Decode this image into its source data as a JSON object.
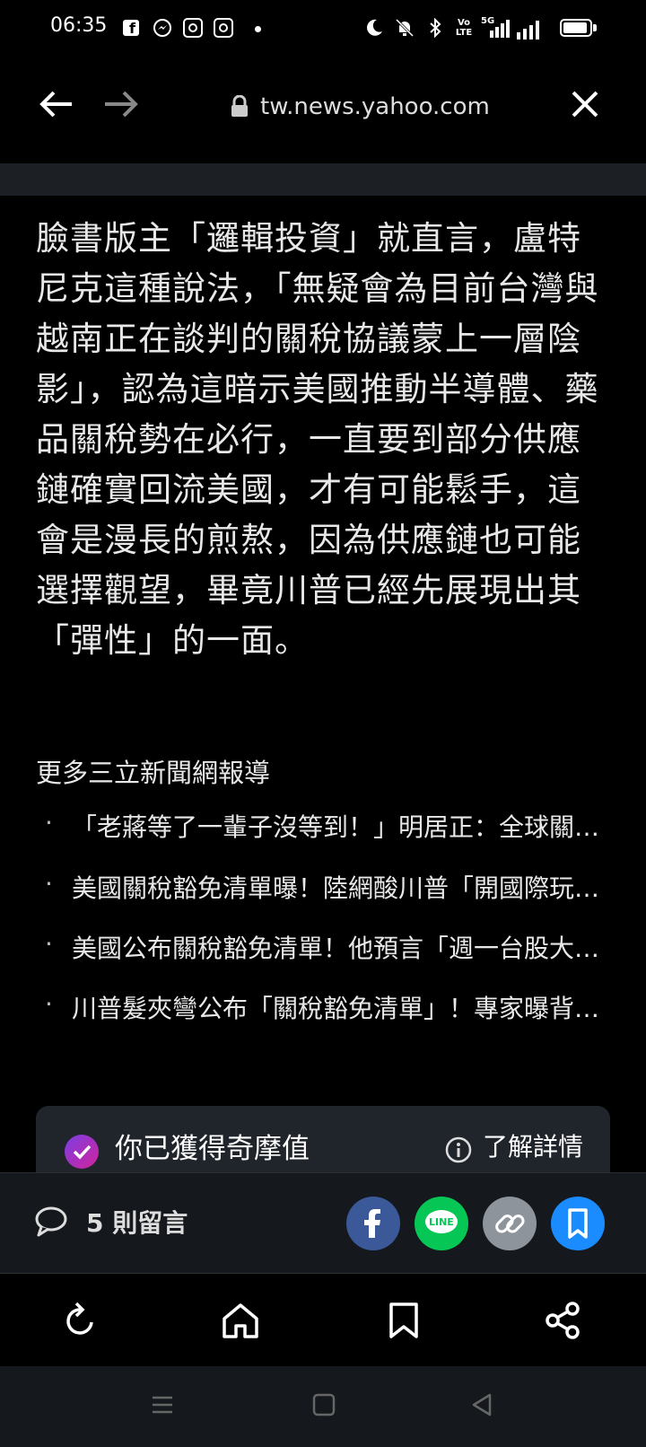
{
  "status_bar": {
    "time": "06:35",
    "notification_icons": [
      "facebook-icon",
      "messenger-icon",
      "instagram-icon",
      "instagram-icon",
      "dot-icon"
    ],
    "system_icons": [
      "moon-icon",
      "bell-muted-icon",
      "bluetooth-icon",
      "volte-icon",
      "signal-5g-icon",
      "signal-icon",
      "battery-icon"
    ],
    "volte_label": "Vo LTE",
    "network_label": "5G"
  },
  "browser": {
    "url": "tw.news.yahoo.com"
  },
  "article": {
    "paragraph": "臉書版主「邏輯投資」就直言，盧特尼克這種說法，「無疑會為目前台灣與越南正在談判的關稅協議蒙上一層陰影」，認為這暗示美國推動半導體、藥品關稅勢在必行，一直要到部分供應鏈確實回流美國，才有可能鬆手，這會是漫長的煎熬，因為供應鏈也可能選擇觀望，畢竟川普已經先展現出其「彈性」的一面。",
    "more_heading": "更多三立新聞網報導",
    "related": [
      {
        "bullet": "·",
        "title": "「老蔣等了一輩子沒等到！」明居正：全球關稅戰台灣最大受益者"
      },
      {
        "bullet": "·",
        "title": "美國關稅豁免清單曝！陸網酸川普「開國際玩笑」"
      },
      {
        "bullet": "·",
        "title": "美國公布關稅豁免清單！他預言「週一台股大反彈」"
      },
      {
        "bullet": "·",
        "title": "川普髮夾彎公布「關稅豁免清單」！專家曝背後原因"
      }
    ]
  },
  "points_card": {
    "text": "你已獲得奇摩值",
    "learn_more": "了解詳情"
  },
  "share_bar": {
    "comments": "5 則留言",
    "line_label": "LINE",
    "colors": {
      "facebook": "#3b5998",
      "line": "#06c755",
      "link": "#8e949c",
      "bookmark": "#1a8cff"
    }
  },
  "bottom_nav": {
    "items": [
      "refresh-icon",
      "home-icon",
      "bookmark-icon",
      "share-icon"
    ]
  }
}
